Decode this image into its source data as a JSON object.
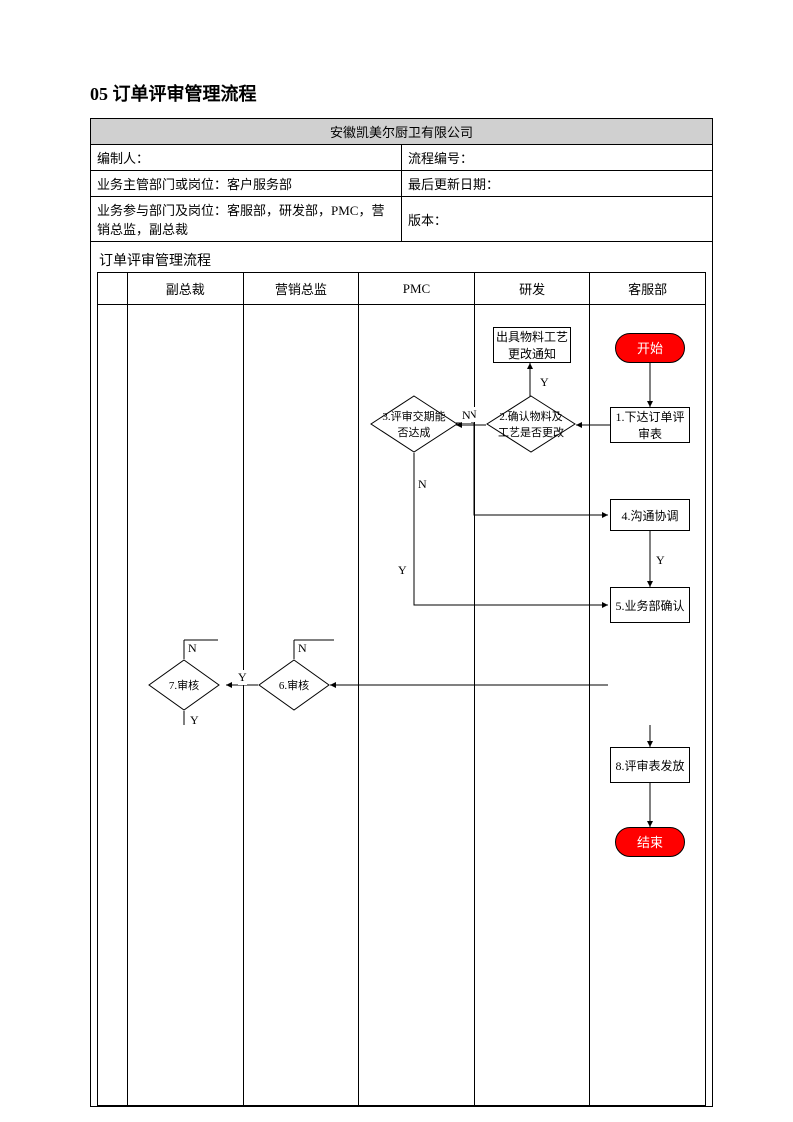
{
  "title": "05 订单评审管理流程",
  "header": {
    "company": "安徽凯美尔厨卫有限公司",
    "author_label": "编制人：",
    "author_value": "",
    "proc_no_label": "流程编号：",
    "proc_no_value": "",
    "dept_label": "业务主管部门或岗位：",
    "dept_value": "客户服务部",
    "update_label": "最后更新日期：",
    "update_value": "",
    "participants_label": "业务参与部门及岗位：",
    "participants_value": "客服部，研发部，PMC，营销总监，副总裁",
    "version_label": "版本：",
    "version_value": ""
  },
  "section_title": "订单评审管理流程",
  "lanes": [
    "副总裁",
    "营销总监",
    "PMC",
    "研发",
    "客服部"
  ],
  "nodes": {
    "start": "开始",
    "end": "结束",
    "notice": "出具物料工艺更改通知",
    "step1": "1.下达订单评审表",
    "step2": "2.确认物料及工艺是否更改",
    "step3": "3.评审交期能否达成",
    "step4": "4.沟通协调",
    "step5": "5.业务部确认",
    "step6": "6.审核",
    "step7": "7.审核",
    "step8": "8.评审表发放"
  },
  "labels": {
    "yes": "Y",
    "no": "N"
  }
}
